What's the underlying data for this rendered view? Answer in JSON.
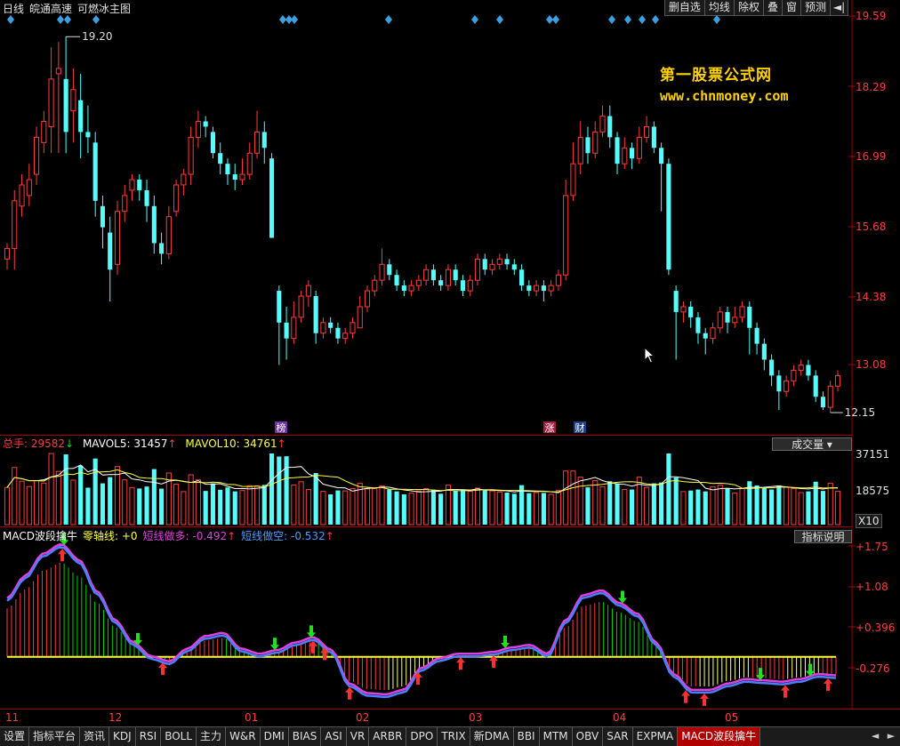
{
  "header": {
    "period": "日线",
    "stock": "皖通高速",
    "indicator": "可燃冰主图"
  },
  "toolbar": {
    "buttons": [
      "删自选",
      "均线",
      "除权",
      "叠",
      "窗",
      "预测"
    ],
    "pin": "◄|"
  },
  "watermark": {
    "line1": "第一股票公式网",
    "line2": "www.chnmoney.com"
  },
  "price_axis": [
    "19.59",
    "18.29",
    "16.99",
    "15.68",
    "14.38",
    "13.08"
  ],
  "annotations": {
    "high": "19.20",
    "low": "12.15",
    "events": [
      "榜",
      "涨",
      "财"
    ]
  },
  "volume_legend": {
    "total_label": "总手: 29582",
    "total_arrow": "↓",
    "mavol5": "MAVOL5: 31457",
    "mavol5_arrow": "↑",
    "mavol10": "MAVOL10: 34761",
    "mavol10_arrow": "↑",
    "button": "成交量",
    "axis": [
      "37151",
      "18575"
    ],
    "unit": "X10"
  },
  "macd_legend": {
    "name": "MACD波段擒牛",
    "zero": "零轴线: +0",
    "short_long": "短线做多: -0.492",
    "short_long_arrow": "↑",
    "short_short": "短线做空: -0.532",
    "short_short_arrow": "↑",
    "button": "指标说明",
    "axis": [
      "+1.75",
      "+1.08",
      "+0.396",
      "-0.276"
    ]
  },
  "x_axis": [
    "11",
    "12",
    "01",
    "02",
    "03",
    "04",
    "05"
  ],
  "tabs": [
    "设置",
    "指标平台",
    "资讯",
    "KDJ",
    "RSI",
    "BOLL",
    "主力",
    "W&R",
    "DMI",
    "BIAS",
    "ASI",
    "VR",
    "ARBR",
    "DPO",
    "TRIX",
    "新DMA",
    "BBI",
    "MTM",
    "OBV",
    "SAR",
    "EXPMA",
    "MACD波段擒牛"
  ],
  "active_tab": "MACD波段擒牛",
  "colors": {
    "up": "#ff3c3c",
    "down": "#54fcfc",
    "grid_line": "#a00000",
    "zero_line": "#ffff40",
    "macd_fast": "#e040e0",
    "macd_slow": "#4a80ff",
    "watermark": "#ffd200"
  },
  "chart_data": {
    "type": "candlestick",
    "ylim": [
      12.0,
      19.59
    ],
    "candles": [
      [
        15.0,
        15.2,
        15.3,
        14.8
      ],
      [
        15.2,
        16.1,
        16.3,
        14.8
      ],
      [
        16.0,
        16.4,
        16.6,
        15.8
      ],
      [
        16.2,
        16.5,
        16.8,
        16.0
      ],
      [
        16.6,
        17.3,
        17.5,
        16.4
      ],
      [
        17.2,
        17.6,
        17.8,
        17.0
      ],
      [
        17.5,
        18.4,
        19.0,
        17.0
      ],
      [
        18.5,
        18.6,
        19.1,
        17.0
      ],
      [
        18.4,
        17.4,
        19.2,
        17.0
      ],
      [
        17.8,
        18.2,
        18.6,
        17.2
      ],
      [
        18.0,
        17.4,
        18.5,
        16.9
      ],
      [
        17.4,
        17.3,
        17.9,
        17.0
      ],
      [
        17.2,
        16.1,
        17.4,
        15.8
      ],
      [
        16.0,
        15.6,
        16.2,
        15.2
      ],
      [
        15.5,
        14.8,
        15.8,
        14.2
      ],
      [
        14.9,
        15.9,
        16.1,
        14.7
      ],
      [
        15.9,
        16.2,
        16.4,
        15.7
      ],
      [
        16.3,
        16.5,
        16.6,
        16.1
      ],
      [
        16.5,
        16.3,
        16.6,
        16.1
      ],
      [
        16.3,
        16.0,
        16.5,
        15.7
      ],
      [
        16.0,
        15.3,
        16.2,
        15.1
      ],
      [
        15.3,
        15.1,
        15.5,
        14.9
      ],
      [
        15.1,
        15.8,
        16.0,
        15.0
      ],
      [
        15.9,
        16.4,
        16.5,
        15.8
      ],
      [
        16.4,
        16.6,
        16.7,
        16.2
      ],
      [
        16.6,
        17.3,
        17.5,
        16.4
      ],
      [
        17.3,
        17.6,
        17.8,
        17.1
      ],
      [
        17.6,
        17.5,
        17.7,
        17.3
      ],
      [
        17.4,
        17.0,
        17.5,
        16.9
      ],
      [
        17.0,
        16.8,
        17.2,
        16.6
      ],
      [
        16.8,
        16.6,
        16.9,
        16.4
      ],
      [
        16.6,
        16.5,
        16.8,
        16.3
      ],
      [
        16.5,
        16.6,
        16.9,
        16.4
      ],
      [
        16.6,
        17.0,
        17.2,
        16.5
      ],
      [
        17.0,
        17.4,
        17.8,
        16.9
      ],
      [
        17.4,
        17.1,
        17.6,
        16.8
      ],
      [
        16.9,
        15.4,
        17.0,
        15.4
      ],
      [
        14.4,
        13.8,
        14.5,
        13.0
      ],
      [
        13.8,
        13.5,
        14.1,
        13.1
      ],
      [
        13.5,
        13.9,
        14.2,
        13.4
      ],
      [
        13.9,
        14.3,
        14.4,
        13.8
      ],
      [
        14.3,
        14.5,
        14.6,
        14.1
      ],
      [
        14.3,
        13.6,
        14.4,
        13.4
      ],
      [
        13.6,
        13.8,
        13.9,
        13.5
      ],
      [
        13.8,
        13.7,
        13.9,
        13.6
      ],
      [
        13.7,
        13.5,
        13.8,
        13.4
      ],
      [
        13.5,
        13.6,
        13.7,
        13.4
      ],
      [
        13.6,
        13.8,
        13.9,
        13.5
      ],
      [
        13.7,
        14.1,
        14.3,
        13.7
      ],
      [
        14.1,
        14.4,
        14.5,
        14.0
      ],
      [
        14.4,
        14.6,
        14.7,
        14.3
      ],
      [
        14.6,
        14.9,
        15.2,
        14.5
      ],
      [
        14.9,
        14.7,
        15.0,
        14.6
      ],
      [
        14.7,
        14.5,
        14.8,
        14.4
      ],
      [
        14.5,
        14.4,
        14.6,
        14.3
      ],
      [
        14.4,
        14.5,
        14.6,
        14.3
      ],
      [
        14.5,
        14.6,
        14.7,
        14.4
      ],
      [
        14.6,
        14.8,
        14.9,
        14.5
      ],
      [
        14.8,
        14.6,
        14.9,
        14.5
      ],
      [
        14.6,
        14.5,
        14.7,
        14.4
      ],
      [
        14.5,
        14.8,
        14.9,
        14.4
      ],
      [
        14.8,
        14.6,
        14.9,
        14.5
      ],
      [
        14.6,
        14.4,
        14.7,
        14.3
      ],
      [
        14.4,
        14.6,
        14.7,
        14.3
      ],
      [
        14.6,
        15.0,
        15.1,
        14.5
      ],
      [
        15.0,
        14.8,
        15.1,
        14.7
      ],
      [
        14.8,
        14.9,
        15.0,
        14.7
      ],
      [
        14.9,
        15.0,
        15.1,
        14.8
      ],
      [
        15.0,
        14.9,
        15.1,
        14.8
      ],
      [
        14.9,
        14.8,
        15.0,
        14.7
      ],
      [
        14.8,
        14.5,
        14.9,
        14.4
      ],
      [
        14.5,
        14.4,
        14.6,
        14.3
      ],
      [
        14.4,
        14.5,
        14.6,
        14.3
      ],
      [
        14.5,
        14.4,
        14.6,
        14.2
      ],
      [
        14.4,
        14.5,
        14.6,
        14.3
      ],
      [
        14.5,
        14.7,
        14.8,
        14.4
      ],
      [
        14.7,
        16.2,
        16.5,
        14.6
      ],
      [
        16.2,
        16.8,
        17.2,
        16.1
      ],
      [
        16.8,
        17.3,
        17.6,
        16.6
      ],
      [
        17.3,
        17.0,
        17.5,
        16.8
      ],
      [
        17.0,
        17.4,
        17.6,
        16.9
      ],
      [
        17.4,
        17.7,
        17.9,
        17.3
      ],
      [
        17.7,
        17.3,
        17.9,
        17.1
      ],
      [
        17.3,
        16.8,
        17.4,
        16.6
      ],
      [
        16.8,
        17.1,
        17.3,
        16.7
      ],
      [
        17.1,
        16.9,
        17.2,
        16.7
      ],
      [
        16.9,
        17.3,
        17.5,
        16.8
      ],
      [
        17.3,
        17.5,
        17.7,
        17.2
      ],
      [
        17.5,
        17.1,
        17.6,
        17.0
      ],
      [
        17.1,
        16.8,
        17.2,
        15.9
      ],
      [
        16.8,
        14.8,
        16.9,
        14.7
      ],
      [
        14.4,
        14.0,
        14.5,
        13.1
      ],
      [
        14.0,
        14.1,
        14.2,
        13.8
      ],
      [
        14.1,
        13.9,
        14.2,
        13.7
      ],
      [
        13.9,
        13.6,
        14.0,
        13.4
      ],
      [
        13.6,
        13.5,
        13.7,
        13.2
      ],
      [
        13.5,
        13.7,
        13.8,
        13.4
      ],
      [
        13.7,
        14.0,
        14.1,
        13.6
      ],
      [
        14.0,
        13.8,
        14.1,
        13.6
      ],
      [
        13.8,
        13.9,
        14.1,
        13.7
      ],
      [
        13.9,
        14.1,
        14.2,
        13.8
      ],
      [
        14.1,
        13.7,
        14.2,
        13.2
      ],
      [
        13.7,
        13.4,
        13.8,
        13.2
      ],
      [
        13.4,
        13.1,
        13.5,
        12.9
      ],
      [
        13.1,
        12.8,
        13.2,
        12.6
      ],
      [
        12.8,
        12.5,
        12.9,
        12.15
      ],
      [
        12.5,
        12.7,
        12.8,
        12.4
      ],
      [
        12.7,
        12.9,
        13.0,
        12.6
      ],
      [
        12.9,
        13.0,
        13.1,
        12.8
      ],
      [
        13.0,
        12.8,
        13.1,
        12.7
      ],
      [
        12.8,
        12.4,
        12.9,
        12.3
      ],
      [
        12.4,
        12.2,
        12.5,
        12.15
      ],
      [
        12.2,
        12.6,
        12.7,
        12.1
      ],
      [
        12.6,
        12.8,
        12.9,
        12.5
      ]
    ],
    "volume_ylim": [
      0,
      37151
    ],
    "volume_pattern": [
      1.0,
      0.8,
      0.9,
      0.7,
      0.6,
      0.8,
      1.2,
      1.0,
      0.9,
      0.7
    ],
    "macd_ylim": [
      -0.72,
      1.75
    ],
    "macd_points": [
      0.9,
      1.25,
      1.6,
      1.75,
      1.5,
      1.0,
      0.55,
      0.2,
      -0.02,
      -0.1,
      0.1,
      0.3,
      0.35,
      0.1,
      0.02,
      0.08,
      0.2,
      0.28,
      0.08,
      -0.45,
      -0.6,
      -0.62,
      -0.55,
      -0.2,
      -0.05,
      0.02,
      0.02,
      0.05,
      0.12,
      0.16,
      0.02,
      0.55,
      0.95,
      1.02,
      0.82,
      0.65,
      0.2,
      -0.3,
      -0.55,
      -0.55,
      -0.45,
      -0.38,
      -0.4,
      -0.42,
      -0.38,
      -0.3,
      -0.32
    ]
  }
}
